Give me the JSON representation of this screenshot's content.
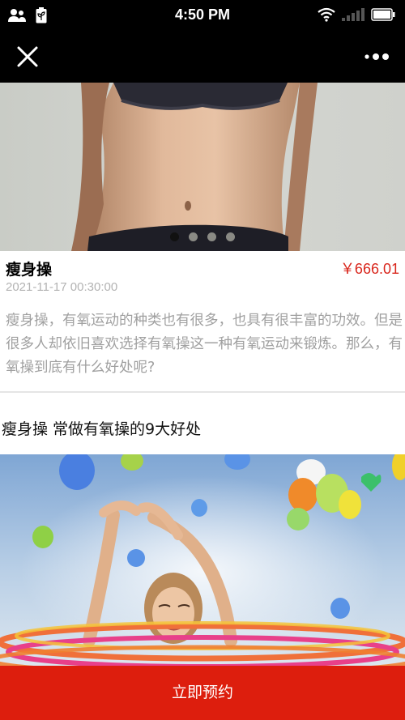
{
  "status_bar": {
    "time": "4:50 PM",
    "icons": [
      "contacts-icon",
      "battery-leaf-icon",
      "wifi-icon",
      "signal-icon",
      "battery-icon"
    ]
  },
  "nav": {
    "close_icon": "close-icon",
    "more_icon": "more-icon"
  },
  "carousel": {
    "slide_count": 4,
    "active_index": 0
  },
  "product": {
    "title": "瘦身操",
    "price": "￥666.01",
    "date": "2021-11-17 00:30:00",
    "description": "瘦身操，有氧运动的种类也有很多，也具有很丰富的功效。但是很多人却依旧喜欢选择有氧操这一种有氧运动来锻炼。那么，有氧操到底有什么好处呢?"
  },
  "article": {
    "heading": "瘦身操 常做有氧操的9大好处"
  },
  "footer": {
    "book_label": "立即预约"
  },
  "colors": {
    "accent_red": "#dd1e0d",
    "price_red": "#d9261c",
    "date_gray": "#b3b3b3",
    "desc_gray": "#a0a0a0"
  }
}
